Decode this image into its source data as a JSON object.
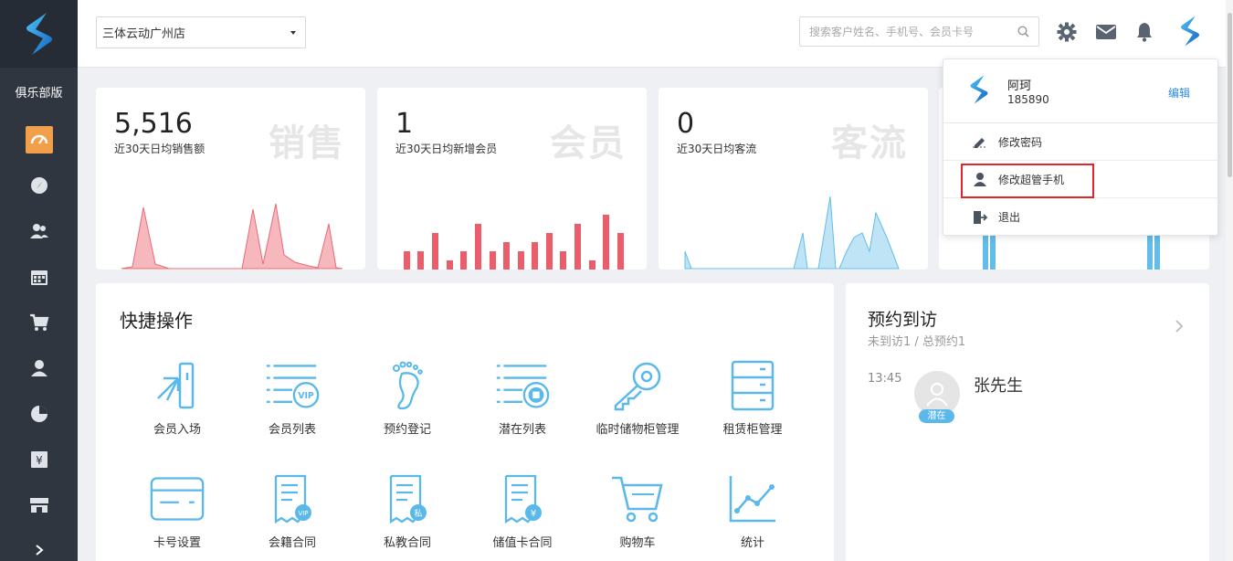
{
  "sidebar": {
    "brand": "俱乐部版",
    "items": [
      {
        "icon": "dashboard-icon",
        "active": true
      },
      {
        "icon": "compass-icon"
      },
      {
        "icon": "members-icon"
      },
      {
        "icon": "calendar-icon"
      },
      {
        "icon": "cart-icon"
      },
      {
        "icon": "user-icon"
      },
      {
        "icon": "pie-chart-icon"
      },
      {
        "icon": "finance-icon"
      },
      {
        "icon": "store-icon"
      }
    ]
  },
  "topbar": {
    "store": "三体云动广州店",
    "search_placeholder": "搜索客户姓名、手机号、会员卡号"
  },
  "stats": [
    {
      "value": "5,516",
      "label": "近30天日均销售额",
      "watermark": "销售"
    },
    {
      "value": "1",
      "label": "近30天日均新增会员",
      "watermark": "会员"
    },
    {
      "value": "0",
      "label": "近30天日均客流",
      "watermark": "客流"
    }
  ],
  "quick": {
    "title": "快捷操作",
    "items": [
      {
        "label": "会员入场",
        "icon": "member-entry-icon"
      },
      {
        "label": "会员列表",
        "icon": "member-list-icon"
      },
      {
        "label": "预约登记",
        "icon": "footprint-icon"
      },
      {
        "label": "潜在列表",
        "icon": "potential-list-icon"
      },
      {
        "label": "临时储物柜管理",
        "icon": "key-icon"
      },
      {
        "label": "租赁柜管理",
        "icon": "cabinet-icon"
      },
      {
        "label": "卡号设置",
        "icon": "card-icon"
      },
      {
        "label": "会籍合同",
        "icon": "vip-contract-icon"
      },
      {
        "label": "私教合同",
        "icon": "private-contract-icon"
      },
      {
        "label": "储值卡合同",
        "icon": "stored-value-contract-icon"
      },
      {
        "label": "购物车",
        "icon": "shopping-cart-icon"
      },
      {
        "label": "统计",
        "icon": "stats-icon"
      }
    ]
  },
  "appointment": {
    "title": "预约到访",
    "subtitle": "未到访1 / 总预约1",
    "entries": [
      {
        "time": "13:45",
        "name": "张先生",
        "badge": "潜在"
      }
    ]
  },
  "dropdown": {
    "name": "阿珂",
    "phone": "185890",
    "edit": "编辑",
    "items": [
      {
        "label": "修改密码",
        "icon": "pencil-icon"
      },
      {
        "label": "修改超管手机",
        "icon": "person-icon"
      },
      {
        "label": "退出",
        "icon": "logout-icon"
      }
    ]
  },
  "colors": {
    "sidebar": "#2f3640",
    "active": "#f0a04b",
    "accent": "#5bb8ea",
    "brand": "#1e88e5",
    "sales": "#e96a75",
    "members": "#ea5d6b",
    "traffic": "#62bde9",
    "highlight": "#e0252b"
  }
}
